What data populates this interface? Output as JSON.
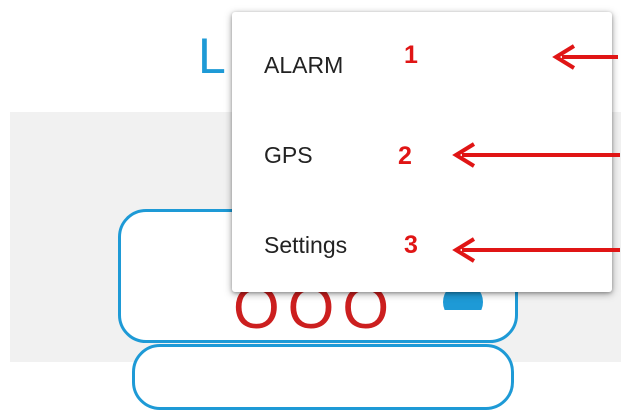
{
  "background": {
    "title_fragment": "L",
    "counter_fragment": "OOO"
  },
  "menu": {
    "items": [
      {
        "label": "ALARM"
      },
      {
        "label": "GPS"
      },
      {
        "label": "Settings"
      }
    ]
  },
  "annotations": {
    "numbers": [
      "1",
      "2",
      "3"
    ],
    "color": "#e01515"
  },
  "colors": {
    "accent": "#1e9ad6",
    "counter": "#cc1f1f",
    "menu_text": "#222222"
  },
  "icons": [
    "globe-icon",
    "arrow-left-icon"
  ]
}
